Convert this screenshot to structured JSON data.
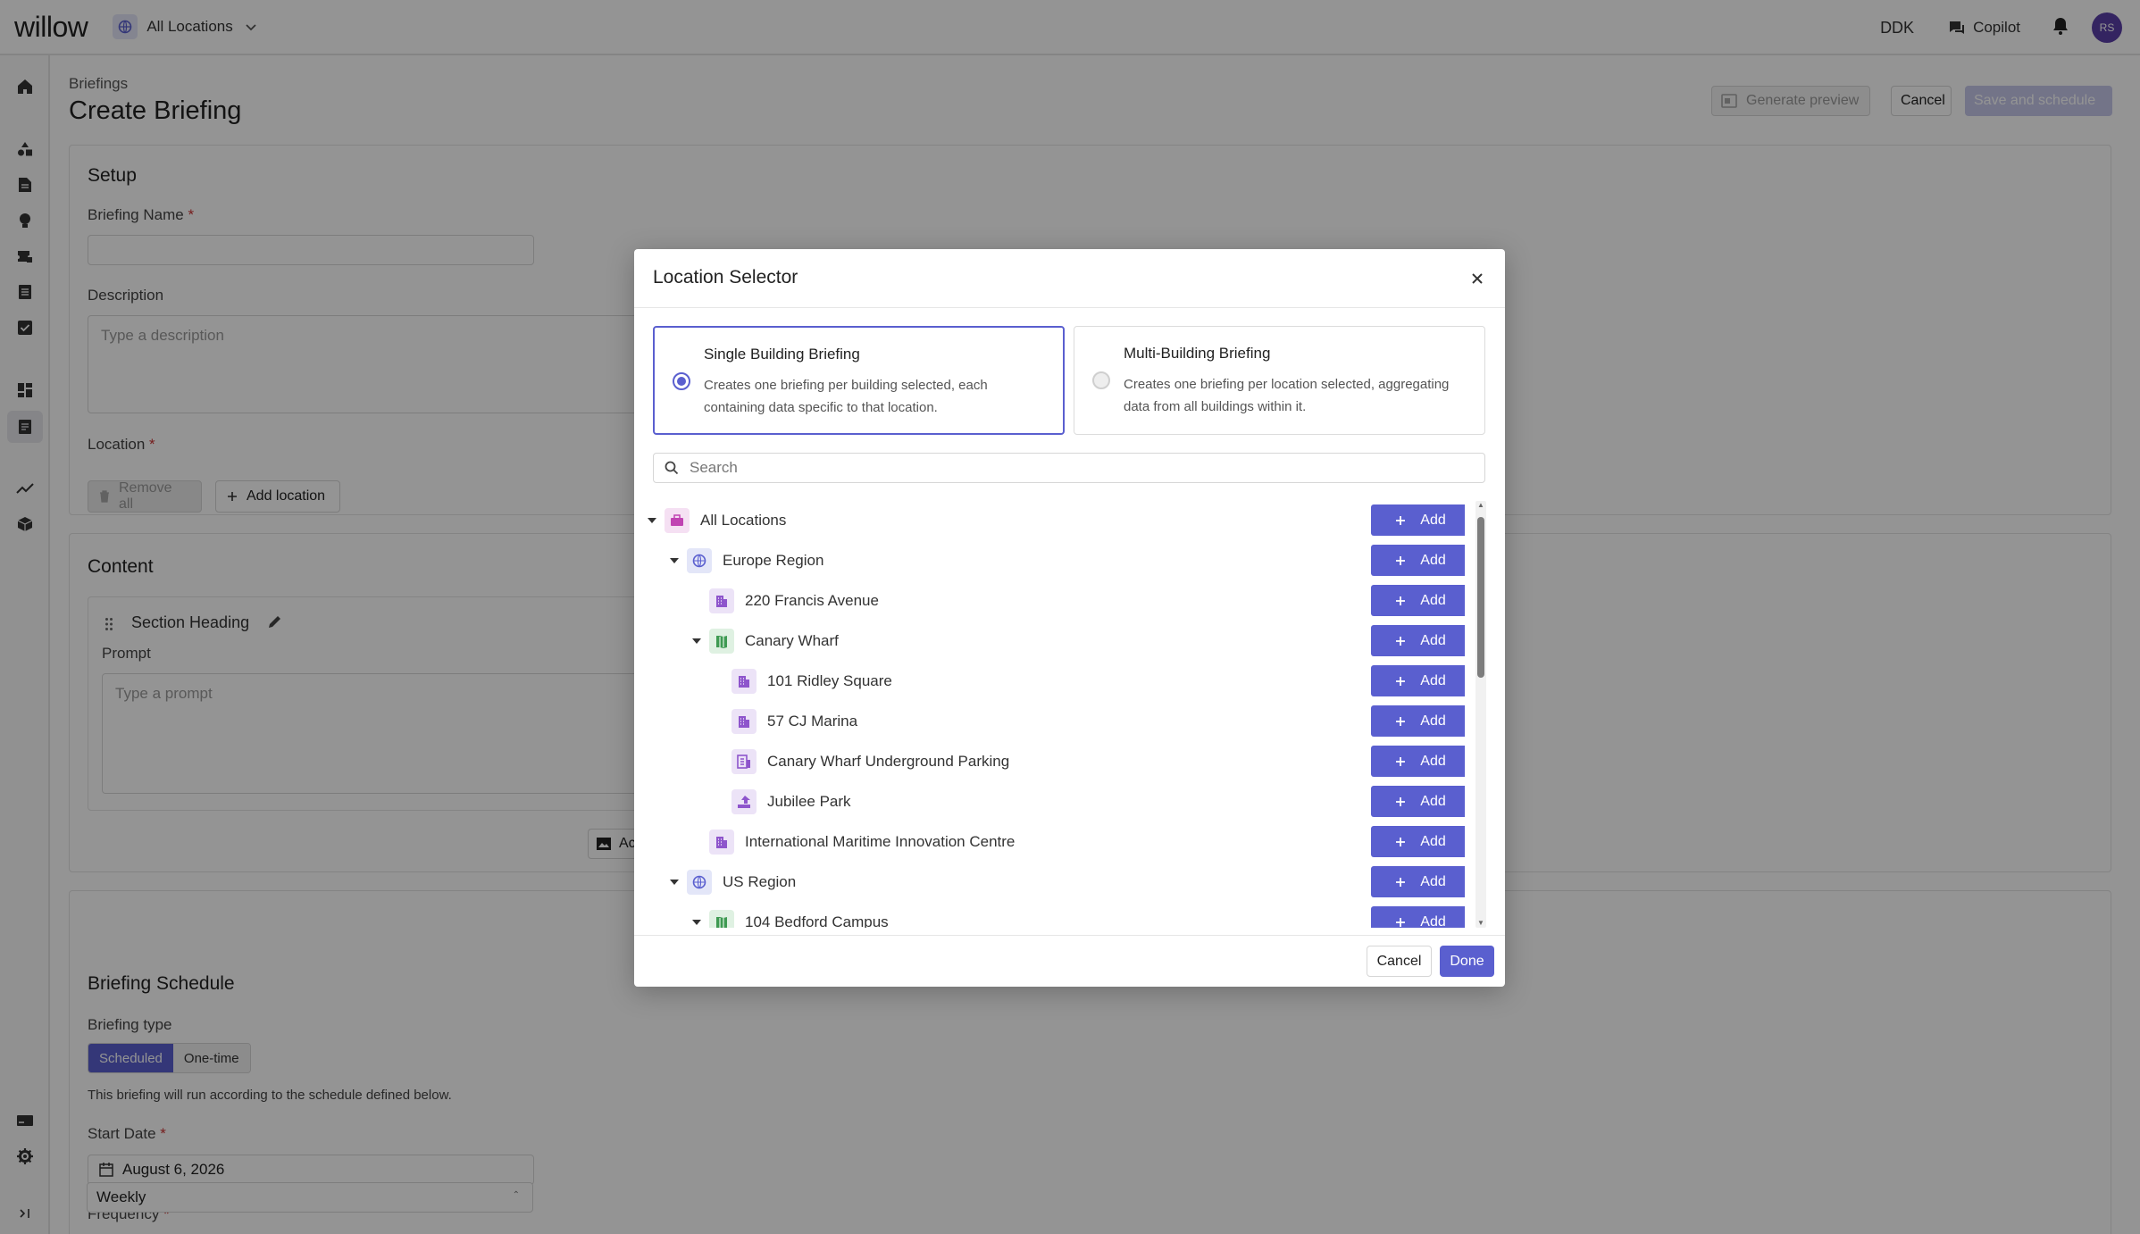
{
  "topbar": {
    "logo": "willow",
    "location_switcher": "All Locations",
    "site_code": "DDK",
    "copilot_label": "Copilot",
    "avatar_initials": "RS"
  },
  "header": {
    "breadcrumb": "Briefings",
    "title": "Create Briefing",
    "generate_preview": "Generate preview",
    "cancel": "Cancel",
    "save_and_schedule": "Save and schedule"
  },
  "setup": {
    "title": "Setup",
    "briefing_name_label": "Briefing Name",
    "required_mark": "*",
    "description_label": "Description",
    "description_placeholder": "Type a description",
    "location_label": "Location",
    "remove_all": "Remove all",
    "add_location": "Add location"
  },
  "content": {
    "title": "Content",
    "section_heading": "Section Heading",
    "prompt_label": "Prompt",
    "prompt_placeholder": "Type a prompt",
    "add_partial": "Ac"
  },
  "schedule": {
    "title": "Briefing Schedule",
    "type_label": "Briefing type",
    "type_options": [
      "Scheduled",
      "One-time"
    ],
    "type_note": "This briefing will run according to the schedule defined below.",
    "start_date_label": "Start Date",
    "start_date_value": "August 6, 2026",
    "frequency_label": "Frequency",
    "frequency_value": "Weekly"
  },
  "modal": {
    "title": "Location Selector",
    "options": [
      {
        "title": "Single Building Briefing",
        "description": "Creates one briefing per building selected, each containing data specific to that location.",
        "selected": true
      },
      {
        "title": "Multi-Building Briefing",
        "description": "Creates one briefing per location selected, aggregating data from all buildings within it.",
        "selected": false
      }
    ],
    "search_placeholder": "Search",
    "add_label": "Add",
    "tree": [
      {
        "name": "All Locations",
        "depth": 0,
        "expandable": true,
        "icon": "portfolio-icon"
      },
      {
        "name": "Europe Region",
        "depth": 1,
        "expandable": true,
        "icon": "globe-icon"
      },
      {
        "name": "220 Francis Avenue",
        "depth": 2,
        "expandable": false,
        "icon": "building-icon"
      },
      {
        "name": "Canary Wharf",
        "depth": 2,
        "expandable": true,
        "icon": "campus-icon"
      },
      {
        "name": "101 Ridley Square",
        "depth": 3,
        "expandable": false,
        "icon": "building-icon"
      },
      {
        "name": "57 CJ Marina",
        "depth": 3,
        "expandable": false,
        "icon": "building-icon"
      },
      {
        "name": "Canary Wharf Underground Parking",
        "depth": 3,
        "expandable": false,
        "icon": "parking-icon"
      },
      {
        "name": "Jubilee Park",
        "depth": 3,
        "expandable": false,
        "icon": "park-icon"
      },
      {
        "name": "International Maritime Innovation Centre",
        "depth": 2,
        "expandable": false,
        "icon": "building-icon"
      },
      {
        "name": "US Region",
        "depth": 1,
        "expandable": true,
        "icon": "globe-icon"
      },
      {
        "name": "104 Bedford Campus",
        "depth": 2,
        "expandable": true,
        "icon": "campus-icon"
      }
    ],
    "cancel": "Cancel",
    "done": "Done"
  },
  "colors": {
    "accent": "#5a5fcf",
    "disabled_accent": "#c6c8ea"
  }
}
